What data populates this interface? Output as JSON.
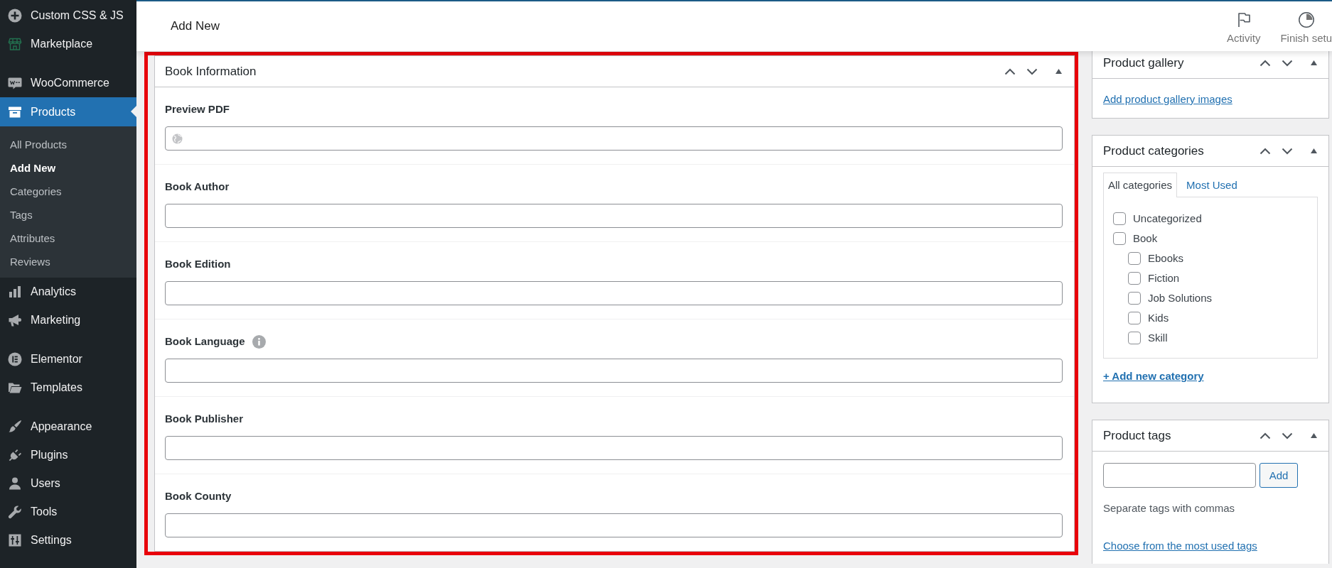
{
  "sidebar": {
    "groups": [
      {
        "items": [
          {
            "label": "Custom CSS & JS",
            "selected": false
          },
          {
            "label": "Marketplace",
            "selected": false
          }
        ]
      },
      {
        "items": [
          {
            "label": "WooCommerce",
            "selected": false
          },
          {
            "label": "Products",
            "selected": true,
            "children": [
              {
                "label": "All Products",
                "selected": false
              },
              {
                "label": "Add New",
                "selected": true
              },
              {
                "label": "Categories",
                "selected": false
              },
              {
                "label": "Tags",
                "selected": false
              },
              {
                "label": "Attributes",
                "selected": false
              },
              {
                "label": "Reviews",
                "selected": false
              }
            ]
          },
          {
            "label": "Analytics",
            "selected": false
          },
          {
            "label": "Marketing",
            "selected": false
          }
        ]
      },
      {
        "items": [
          {
            "label": "Elementor",
            "selected": false
          },
          {
            "label": "Templates",
            "selected": false
          }
        ]
      },
      {
        "items": [
          {
            "label": "Appearance",
            "selected": false
          },
          {
            "label": "Plugins",
            "selected": false
          },
          {
            "label": "Users",
            "selected": false
          },
          {
            "label": "Tools",
            "selected": false
          },
          {
            "label": "Settings",
            "selected": false
          }
        ]
      }
    ]
  },
  "header": {
    "title": "Add New",
    "actions": [
      {
        "label": "Activity"
      },
      {
        "label": "Finish setu"
      }
    ]
  },
  "main_box": {
    "title": "Book Information",
    "fields": [
      {
        "label": "Preview PDF",
        "kind": "url",
        "help": false
      },
      {
        "label": "Book Author",
        "kind": "text",
        "help": false
      },
      {
        "label": "Book Edition",
        "kind": "text",
        "help": false
      },
      {
        "label": "Book Language",
        "kind": "text",
        "help": true
      },
      {
        "label": "Book Publisher",
        "kind": "text",
        "help": false
      },
      {
        "label": "Book County",
        "kind": "text",
        "help": false
      }
    ]
  },
  "side_boxes": [
    {
      "kind": "gallery",
      "title": "Product gallery",
      "link": "Add product gallery images"
    },
    {
      "kind": "categories",
      "title": "Product categories",
      "tabs": [
        {
          "label": "All categories",
          "selected": true
        },
        {
          "label": "Most Used",
          "selected": false
        }
      ],
      "categories": [
        {
          "label": "Uncategorized",
          "checked": false
        },
        {
          "label": "Book",
          "checked": false,
          "children": [
            {
              "label": "Ebooks",
              "checked": false
            },
            {
              "label": "Fiction",
              "checked": false
            },
            {
              "label": "Job Solutions",
              "checked": false
            },
            {
              "label": "Kids",
              "checked": false
            },
            {
              "label": "Skill",
              "checked": false
            }
          ]
        }
      ],
      "add_link": "+ Add new category"
    },
    {
      "kind": "tags",
      "title": "Product tags",
      "button": "Add",
      "hint": "Separate tags with commas",
      "link": "Choose from the most used tags"
    }
  ]
}
